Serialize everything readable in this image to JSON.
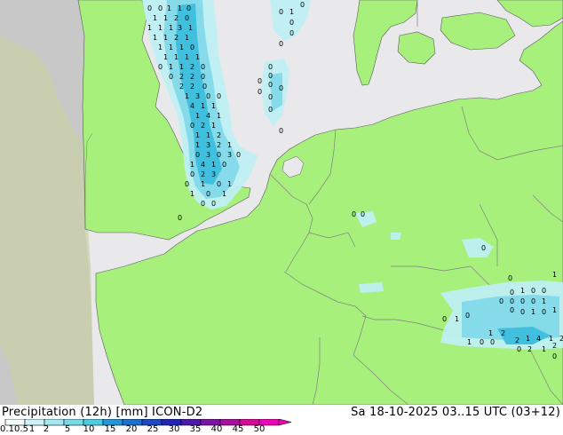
{
  "footer": {
    "title": "Precipitation (12h) [mm] ICON-D2",
    "valid_time": "Sa 18-10-2025 03..15 UTC (03+12)"
  },
  "colorbar": {
    "labels": [
      "0.1",
      "0.5",
      "1",
      "2",
      "5",
      "10",
      "15",
      "20",
      "25",
      "30",
      "35",
      "40",
      "45",
      "50"
    ],
    "colors": [
      "#f4fcfd",
      "#cdf2f7",
      "#a3e8f0",
      "#78dbe9",
      "#4dcbe0",
      "#2596d6",
      "#1e6fcd",
      "#1a4ac4",
      "#1f24b6",
      "#4b1aa8",
      "#7a14a2",
      "#a70f9c",
      "#d20a96",
      "#f004b8"
    ]
  },
  "map": {
    "colors": {
      "sea": "#e9e9ec",
      "land_in_domain": "#a8f07c",
      "land_outside_domain": "#c8c8c8",
      "land_outside_domain_shade": "#c9d2aa",
      "border": "#808080",
      "coast": "#5a5a5a",
      "rain_light": "#bff0f4",
      "rain_moderate": "#86dbea",
      "rain_heavy": "#40c0de"
    }
  }
}
